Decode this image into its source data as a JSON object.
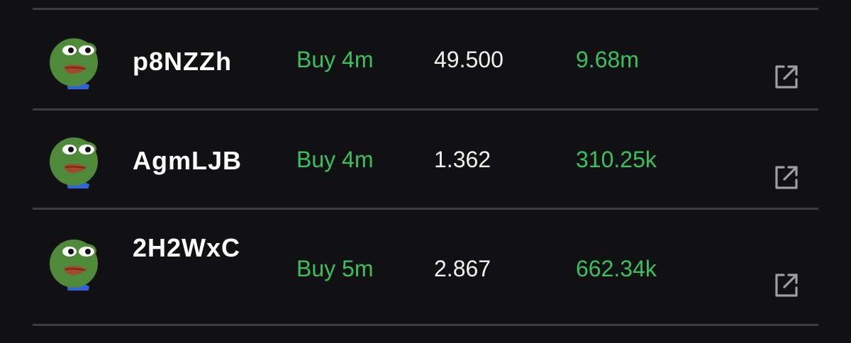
{
  "colors": {
    "background": "#111113",
    "divider": "#3a3d44",
    "buy": "#3bbf5f",
    "text": "#ffffff"
  },
  "rows": [
    {
      "avatar_icon": "pepe-frog-avatar",
      "name": "p8NZZh",
      "action": "Buy 4m",
      "amount": "49.500",
      "value": "9.68m",
      "link_icon": "external-link-icon"
    },
    {
      "avatar_icon": "pepe-frog-avatar",
      "name": "AgmLJB",
      "action": "Buy 4m",
      "amount": "1.362",
      "value": "310.25k",
      "link_icon": "external-link-icon"
    },
    {
      "avatar_icon": "pepe-frog-avatar",
      "name": "2H2WxC",
      "action": "Buy 5m",
      "amount": "2.867",
      "value": "662.34k",
      "link_icon": "external-link-icon"
    }
  ]
}
